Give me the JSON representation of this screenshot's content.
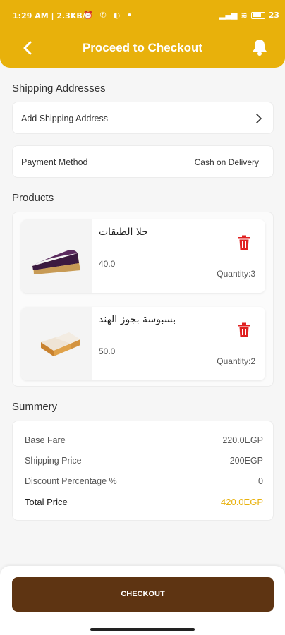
{
  "status_bar": {
    "time": "1:29 AM",
    "net_speed": "2.3KB/s",
    "battery": "23"
  },
  "header": {
    "title": "Proceed to Checkout",
    "back_icon": "chevron-left-icon",
    "bell_icon": "bell-icon"
  },
  "shipping": {
    "section_title": "Shipping Addresses",
    "add_label": "Add Shipping Address"
  },
  "payment": {
    "label": "Payment Method",
    "value": "Cash on Delivery"
  },
  "products": {
    "section_title": "Products",
    "items": [
      {
        "name": "حلا الطبقات",
        "price": "40.0",
        "quantity": "Quantity:3"
      },
      {
        "name": "بسبوسة بجوز الهند",
        "price": "50.0",
        "quantity": "Quantity:2"
      }
    ]
  },
  "summary": {
    "section_title": "Summery",
    "base_fare_label": "Base Fare",
    "base_fare_value": "220.0EGP",
    "shipping_label": "Shipping Price",
    "shipping_value": "200EGP",
    "discount_label": "Discount Percentage %",
    "discount_value": "0",
    "total_label": "Total Price",
    "total_value": "420.0EGP"
  },
  "checkout": {
    "label": "CHECKOUT"
  },
  "colors": {
    "accent": "#e8b10b",
    "button": "#5e3412",
    "delete": "#e02020",
    "total": "#e8b10b"
  }
}
